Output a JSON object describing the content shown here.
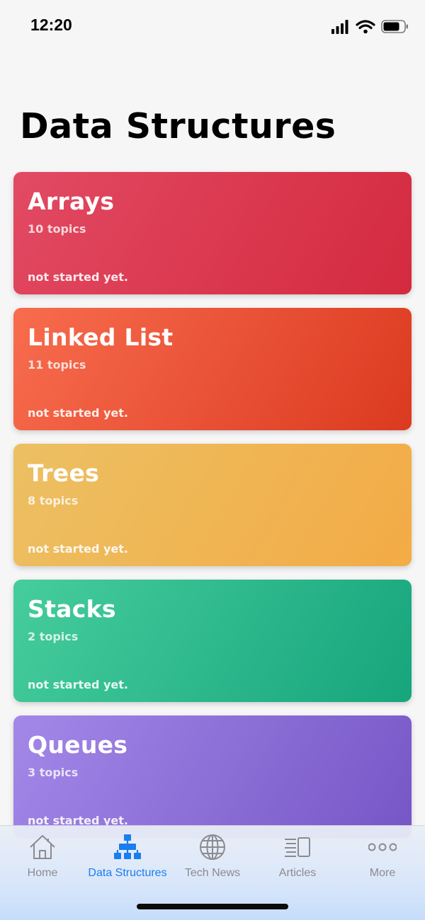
{
  "status_bar": {
    "time": "12:20"
  },
  "header": {
    "title": "Data Structures"
  },
  "cards": [
    {
      "title": "Arrays",
      "topics": "10 topics",
      "status": "not started yet.",
      "color": "#d42a3f"
    },
    {
      "title": "Linked List",
      "topics": "11 topics",
      "status": "not started yet.",
      "color": "#db3a20"
    },
    {
      "title": "Trees",
      "topics": "8 topics",
      "status": "not started yet.",
      "color": "#f3ab45"
    },
    {
      "title": "Stacks",
      "topics": "2 topics",
      "status": "not started yet.",
      "color": "#17a57c"
    },
    {
      "title": "Queues",
      "topics": "3 topics",
      "status": "not started yet.",
      "color": "#7656c6"
    }
  ],
  "tab_bar": {
    "items": [
      {
        "label": "Home",
        "icon": "home-icon",
        "active": false
      },
      {
        "label": "Data Structures",
        "icon": "hierarchy-icon",
        "active": true
      },
      {
        "label": "Tech News",
        "icon": "globe-icon",
        "active": false
      },
      {
        "label": "Articles",
        "icon": "articles-icon",
        "active": false
      },
      {
        "label": "More",
        "icon": "more-icon",
        "active": false
      }
    ],
    "active_color": "#1a7df0",
    "inactive_color": "#8b8b8f"
  }
}
